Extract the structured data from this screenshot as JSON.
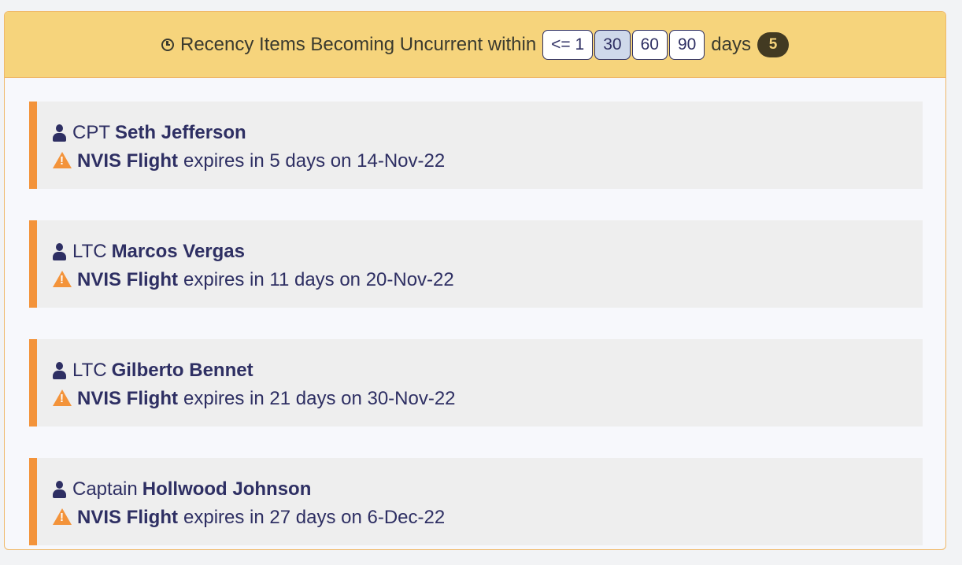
{
  "header": {
    "icon": "clock-icon",
    "title": "Recency Items Becoming Uncurrent within",
    "ranges": [
      {
        "label": "<= 1",
        "active": false
      },
      {
        "label": "30",
        "active": true
      },
      {
        "label": "60",
        "active": false
      },
      {
        "label": "90",
        "active": false
      }
    ],
    "unit_label": "days",
    "count": "5"
  },
  "colors": {
    "header_bg": "#f6d47c",
    "accent": "#f3933a",
    "text": "#2e2f63",
    "badge_bg": "#423a22"
  },
  "items": [
    {
      "rank": "CPT",
      "name": "Seth Jefferson",
      "qualification": "NVIS Flight",
      "detail": "expires in 5 days on 14-Nov-22"
    },
    {
      "rank": "LTC",
      "name": "Marcos Vergas",
      "qualification": "NVIS Flight",
      "detail": "expires in 11 days on 20-Nov-22"
    },
    {
      "rank": "LTC",
      "name": "Gilberto Bennet",
      "qualification": "NVIS Flight",
      "detail": "expires in 21 days on 30-Nov-22"
    },
    {
      "rank": "Captain",
      "name": "Hollwood Johnson",
      "qualification": "NVIS Flight",
      "detail": "expires in 27 days on 6-Dec-22"
    }
  ]
}
